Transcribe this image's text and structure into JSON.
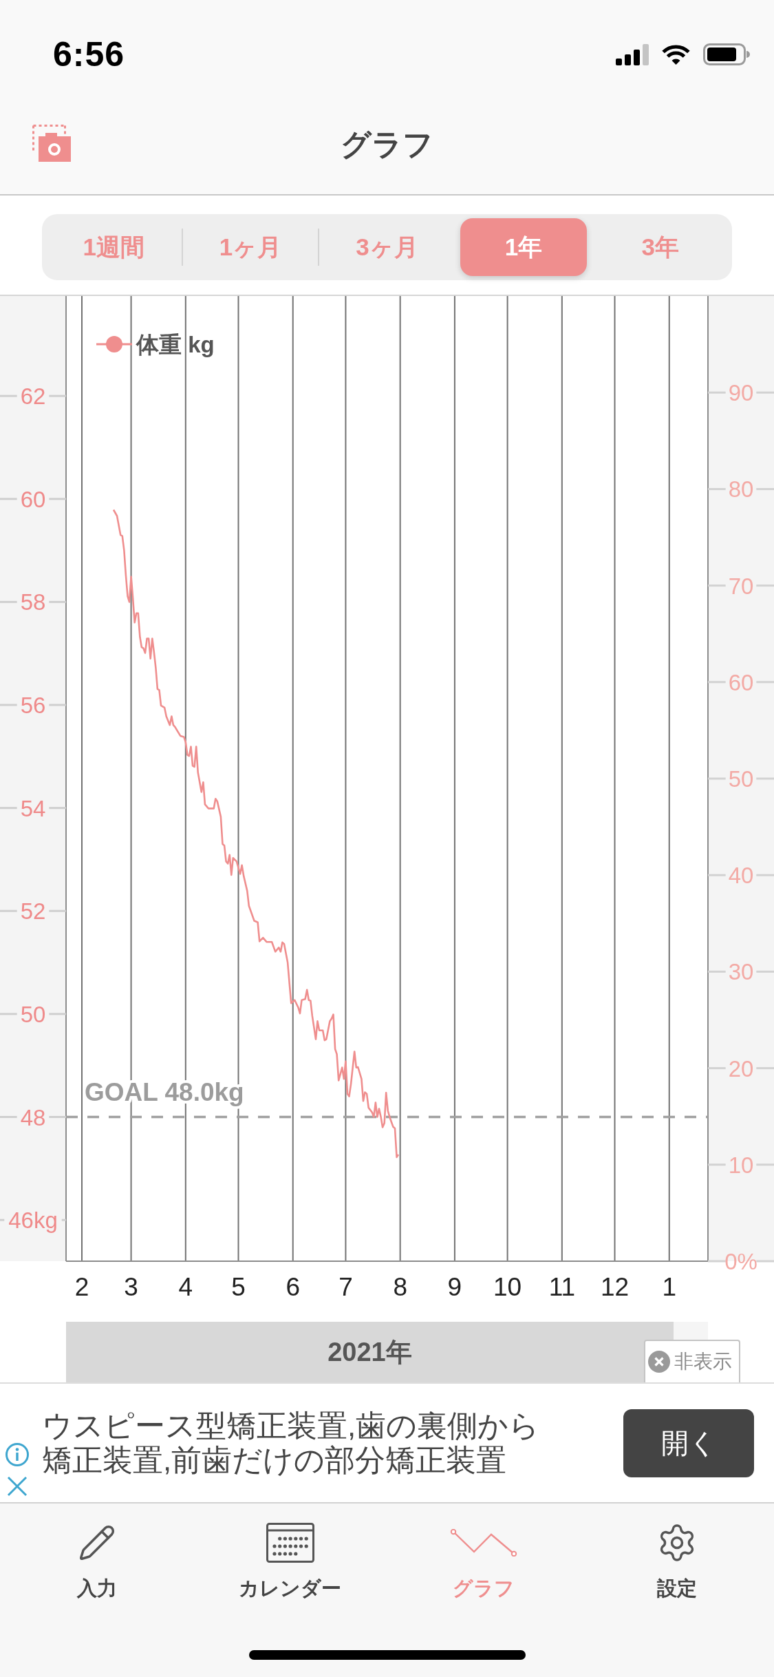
{
  "status_bar": {
    "time": "6:56"
  },
  "header": {
    "title": "グラフ"
  },
  "period_tabs": [
    {
      "label": "1週間",
      "selected": false
    },
    {
      "label": "1ヶ月",
      "selected": false
    },
    {
      "label": "3ヶ月",
      "selected": false
    },
    {
      "label": "1年",
      "selected": true
    },
    {
      "label": "3年",
      "selected": false
    }
  ],
  "chart": {
    "chart_data": {
      "type": "line",
      "grid": true,
      "x": [
        "2021-02-19",
        "2021-02-21",
        "2021-02-23",
        "2021-02-24",
        "2021-02-25",
        "2021-02-26",
        "2021-02-27",
        "2021-02-28",
        "2021-03-01",
        "2021-03-02",
        "2021-03-03",
        "2021-03-04",
        "2021-03-05",
        "2021-03-06",
        "2021-03-07",
        "2021-03-08",
        "2021-03-09",
        "2021-03-10",
        "2021-03-11",
        "2021-03-12",
        "2021-03-13",
        "2021-03-14",
        "2021-03-15",
        "2021-03-16",
        "2021-03-17",
        "2021-03-18",
        "2021-03-20",
        "2021-03-21",
        "2021-03-23",
        "2021-03-24",
        "2021-03-25",
        "2021-03-26",
        "2021-03-29",
        "2021-03-31",
        "2021-04-01",
        "2021-04-02",
        "2021-04-03",
        "2021-04-04",
        "2021-04-05",
        "2021-04-06",
        "2021-04-07",
        "2021-04-08",
        "2021-04-10",
        "2021-04-11",
        "2021-04-12",
        "2021-04-14",
        "2021-04-17",
        "2021-04-18",
        "2021-04-19",
        "2021-04-21",
        "2021-04-22",
        "2021-04-23",
        "2021-04-24",
        "2021-04-25",
        "2021-04-26",
        "2021-04-27",
        "2021-04-28",
        "2021-04-30",
        "2021-05-02",
        "2021-05-03",
        "2021-05-04",
        "2021-05-06",
        "2021-05-07",
        "2021-05-10",
        "2021-05-12",
        "2021-05-13",
        "2021-05-15",
        "2021-05-17",
        "2021-05-20",
        "2021-05-22",
        "2021-05-24",
        "2021-05-25",
        "2021-05-26",
        "2021-05-27",
        "2021-05-29",
        "2021-05-30",
        "2021-05-31",
        "2021-06-02",
        "2021-06-04",
        "2021-06-05",
        "2021-06-06",
        "2021-06-08",
        "2021-06-09",
        "2021-06-10",
        "2021-06-11",
        "2021-06-12",
        "2021-06-14",
        "2021-06-15",
        "2021-06-16",
        "2021-06-18",
        "2021-06-19",
        "2021-06-20",
        "2021-06-22",
        "2021-06-23",
        "2021-06-24",
        "2021-06-25",
        "2021-06-26",
        "2021-06-27",
        "2021-06-29",
        "2021-06-30",
        "2021-07-01",
        "2021-07-02",
        "2021-07-03",
        "2021-07-04",
        "2021-07-06",
        "2021-07-07",
        "2021-07-08",
        "2021-07-10",
        "2021-07-11",
        "2021-07-12",
        "2021-07-13",
        "2021-07-14",
        "2021-07-16",
        "2021-07-17",
        "2021-07-18",
        "2021-07-19",
        "2021-07-20",
        "2021-07-21",
        "2021-07-22",
        "2021-07-23",
        "2021-07-24",
        "2021-07-25",
        "2021-07-26",
        "2021-07-28",
        "2021-07-29",
        "2021-07-30",
        "2021-07-31"
      ],
      "series": [
        {
          "name": "体重 kg",
          "color": "#ef8e8e",
          "values": [
            59.79,
            59.67,
            59.3,
            59.28,
            59.0,
            58.52,
            58.11,
            58.0,
            58.49,
            58.08,
            57.6,
            57.78,
            57.78,
            57.32,
            57.12,
            57.1,
            57.01,
            57.29,
            57.29,
            56.9,
            57.29,
            57.03,
            56.72,
            56.31,
            56.29,
            55.99,
            55.95,
            55.78,
            55.61,
            55.78,
            55.61,
            55.57,
            55.4,
            55.38,
            55.28,
            55.03,
            55.01,
            55.19,
            54.82,
            54.8,
            55.19,
            54.69,
            54.31,
            54.5,
            54.07,
            53.99,
            53.99,
            54.18,
            54.13,
            53.83,
            53.3,
            53.27,
            52.96,
            52.92,
            53.09,
            52.7,
            53.03,
            52.96,
            52.72,
            52.89,
            52.68,
            52.39,
            52.1,
            51.81,
            51.78,
            51.41,
            51.48,
            51.4,
            51.4,
            51.21,
            51.29,
            51.21,
            51.39,
            51.36,
            51.0,
            50.61,
            50.21,
            50.27,
            50.13,
            50.01,
            50.27,
            50.29,
            50.47,
            50.27,
            50.26,
            49.96,
            49.51,
            49.86,
            49.68,
            49.68,
            49.49,
            49.51,
            49.86,
            49.91,
            49.99,
            49.32,
            49.22,
            48.71,
            48.96,
            48.74,
            49.08,
            48.45,
            48.4,
            48.64,
            49.27,
            48.96,
            48.97,
            48.74,
            48.31,
            48.48,
            48.45,
            48.18,
            48.09,
            48.0,
            48.28,
            48.0,
            48.16,
            48.0,
            47.8,
            47.88,
            48.47,
            48.12,
            48.0,
            47.81,
            47.78,
            47.22,
            47.27
          ]
        }
      ],
      "xlim": [
        "2021-01-23",
        "2022-01-23"
      ],
      "ylim": [
        45.2,
        63.94
      ],
      "xticks": [
        {
          "value": "2021-02-01",
          "label": "2"
        },
        {
          "value": "2021-03-01",
          "label": "3"
        },
        {
          "value": "2021-04-01",
          "label": "4"
        },
        {
          "value": "2021-05-01",
          "label": "5"
        },
        {
          "value": "2021-06-01",
          "label": "6"
        },
        {
          "value": "2021-07-01",
          "label": "7"
        },
        {
          "value": "2021-08-01",
          "label": "8"
        },
        {
          "value": "2021-09-01",
          "label": "9"
        },
        {
          "value": "2021-10-01",
          "label": "10"
        },
        {
          "value": "2021-11-01",
          "label": "11"
        },
        {
          "value": "2021-12-01",
          "label": "12"
        },
        {
          "value": "2022-01-01",
          "label": "1"
        }
      ],
      "yticks": [
        {
          "value": 46,
          "label": "46kg"
        },
        48,
        50,
        52,
        54,
        56,
        58,
        60,
        62
      ],
      "ref_lines": [
        {
          "axis": "y",
          "value": 48,
          "label": "GOAL 48.0kg"
        }
      ]
    },
    "right_axis": {
      "ticks": [
        "90",
        "80",
        "70",
        "60",
        "50",
        "40",
        "30",
        "20",
        "10",
        "0%"
      ]
    }
  },
  "year_band": {
    "label": "2021年"
  },
  "ad": {
    "hide_label": "非表示",
    "text": "ウスピース型矯正装置,歯の裏側から矯正装置,前歯だけの部分矯正装置",
    "button": "開く"
  },
  "nav_tabs": [
    {
      "label": "入力",
      "selected": false
    },
    {
      "label": "カレンダー",
      "selected": false
    },
    {
      "label": "グラフ",
      "selected": true
    },
    {
      "label": "設定",
      "selected": false
    }
  ]
}
